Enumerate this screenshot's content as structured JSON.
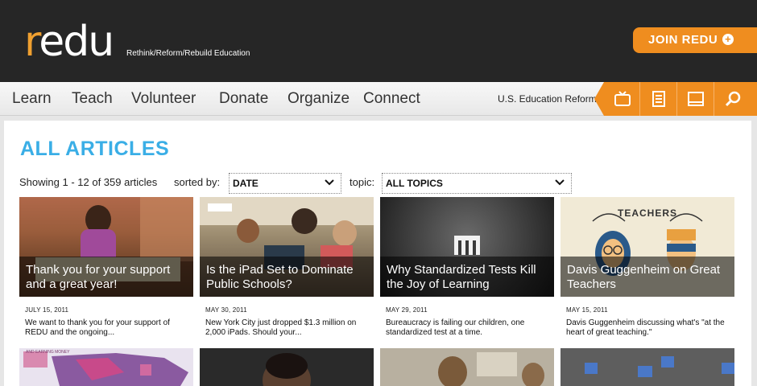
{
  "header": {
    "logo_prefix": "r",
    "logo_rest": "edu",
    "tagline": "Rethink/Reform/Rebuild Education",
    "join_label": "JOIN REDU",
    "join_plus": "+"
  },
  "nav": {
    "items": [
      "Learn",
      "Teach",
      "Volunteer",
      "Donate",
      "Organize",
      "Connect"
    ],
    "reform_link": "U.S. Education Reform",
    "icons": [
      "tv-icon",
      "document-icon",
      "screen-icon",
      "search-icon"
    ]
  },
  "main": {
    "title": "ALL ARTICLES",
    "showing": "Showing 1 - 12 of 359 articles",
    "sorted_label": "sorted by:",
    "sort_value": "DATE",
    "topic_label": "topic:",
    "topic_value": "ALL TOPICS"
  },
  "articles": [
    {
      "title": "Thank you for your support and a great year!",
      "date": "JULY 15, 2011",
      "desc": "We want to thank you for your support of REDU and the ongoing..."
    },
    {
      "title": "Is the iPad Set to Dominate Public Schools?",
      "date": "MAY 30, 2011",
      "desc": "New York City just dropped $1.3 million on 2,000 iPads. Should your..."
    },
    {
      "title": "Why Standardized Tests Kill the Joy of Learning",
      "date": "MAY 29, 2011",
      "desc": "Bureaucracy is failing our children, one standardized test at a time."
    },
    {
      "title": "Davis Guggenheim on Great Teachers",
      "date": "MAY 15, 2011",
      "desc": "Davis Guggenheim discussing what's \"at the heart of great teaching.\"",
      "image_text": "TEACHERS"
    }
  ],
  "row2_image_text": "AND EARNING MONEY",
  "colors": {
    "accent_orange": "#ef8d1f",
    "title_blue": "#3aaee6",
    "header_bg": "#262626"
  }
}
